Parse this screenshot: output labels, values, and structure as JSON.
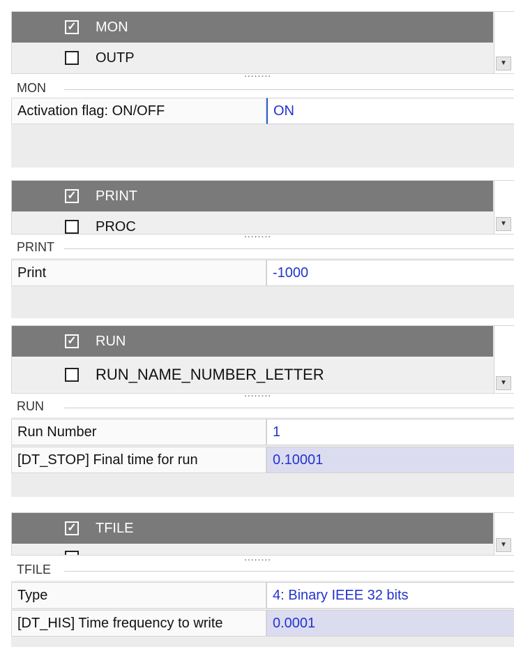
{
  "sections": [
    {
      "list": [
        {
          "label": "MON",
          "checked": true,
          "selected": true
        },
        {
          "label": "OUTP",
          "checked": false,
          "selected": false
        }
      ],
      "group_title": "MON",
      "props": [
        {
          "label": "Activation flag: ON/OFF",
          "value": "ON"
        }
      ]
    },
    {
      "list": [
        {
          "label": "PRINT",
          "checked": true,
          "selected": true
        },
        {
          "label": "PROC",
          "checked": false,
          "selected": false
        }
      ],
      "group_title": "PRINT",
      "props": [
        {
          "label": "Print",
          "value": "-1000"
        }
      ]
    },
    {
      "list": [
        {
          "label": "RUN",
          "checked": true,
          "selected": true
        },
        {
          "label": "RUN_NAME_NUMBER_LETTER",
          "checked": false,
          "selected": false
        }
      ],
      "group_title": "RUN",
      "props": [
        {
          "label": "Run Number",
          "value": "1"
        },
        {
          "label": "[DT_STOP] Final time for run",
          "value": "0.10001"
        }
      ]
    },
    {
      "list": [
        {
          "label": "TFILE",
          "checked": true,
          "selected": true
        }
      ],
      "group_title": "TFILE",
      "props": [
        {
          "label": "Type",
          "value": "4: Binary IEEE 32 bits"
        },
        {
          "label": "[DT_HIS] Time frequency to write",
          "value": "0.0001"
        }
      ]
    }
  ],
  "splitter_text": "........",
  "checkbox_glyph": "✓",
  "scroll_down_glyph": "▼",
  "colors": {
    "selected_row": "#7a7a7a",
    "value_text": "#2233cc",
    "highlight_value": "#dcdcf0"
  }
}
